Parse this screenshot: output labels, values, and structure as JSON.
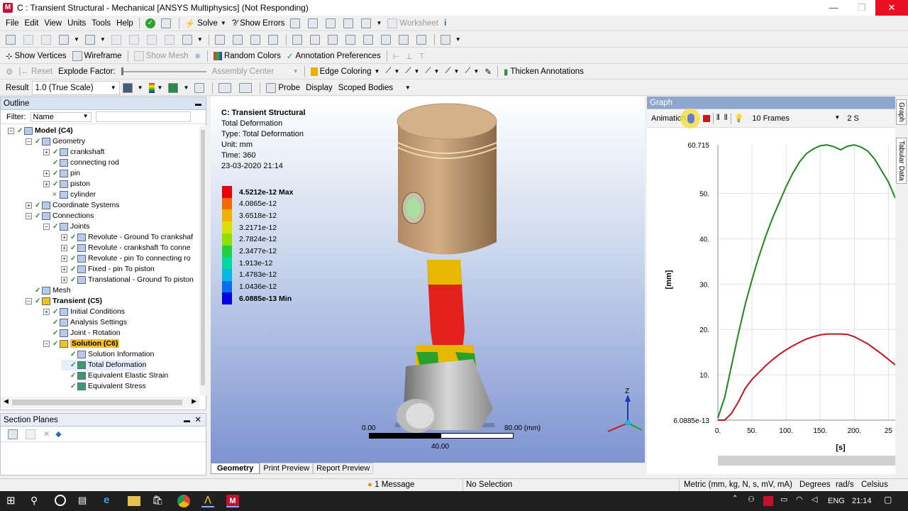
{
  "window": {
    "title": "C : Transient Structural - Mechanical [ANSYS Multiphysics] (Not Responding)",
    "minimize": "—",
    "maximize": "❐",
    "close": "✕"
  },
  "menu": [
    "File",
    "Edit",
    "View",
    "Units",
    "Tools",
    "Help"
  ],
  "toolbar1": {
    "solve": "Solve",
    "show_errors": "Show Errors",
    "worksheet": "Worksheet"
  },
  "toolbar3": {
    "show_vertices": "Show Vertices",
    "wireframe": "Wireframe",
    "show_mesh": "Show Mesh",
    "random_colors": "Random Colors",
    "annotation_preferences": "Annotation Preferences"
  },
  "toolbar4": {
    "reset": "Reset",
    "explode_factor": "Explode Factor:",
    "assembly_center": "Assembly Center",
    "edge_coloring": "Edge Coloring",
    "thicken_annotations": "Thicken Annotations"
  },
  "toolbar5": {
    "result_label": "Result",
    "result_value": "1.0 (True Scale)",
    "probe": "Probe",
    "display": "Display",
    "display_value": "Scoped Bodies"
  },
  "outline": {
    "title": "Outline",
    "pin": "📌",
    "filter_label": "Filter:",
    "filter_value": "Name",
    "items": [
      {
        "label": "Model (C4)",
        "bold": true
      },
      {
        "label": "Geometry"
      },
      {
        "label": "crankshaft"
      },
      {
        "label": "connecting rod"
      },
      {
        "label": "pin"
      },
      {
        "label": "piston"
      },
      {
        "label": "cylinder"
      },
      {
        "label": "Coordinate Systems"
      },
      {
        "label": "Connections"
      },
      {
        "label": "Joints"
      },
      {
        "label": "Revolute - Ground To crankshaf"
      },
      {
        "label": "Revolute - crankshaft To conne"
      },
      {
        "label": "Revolute - pin To connecting ro"
      },
      {
        "label": "Fixed - pin To piston"
      },
      {
        "label": "Translational - Ground To piston"
      },
      {
        "label": "Mesh"
      },
      {
        "label": "Transient (C5)",
        "bold": true
      },
      {
        "label": "Initial Conditions"
      },
      {
        "label": "Analysis Settings"
      },
      {
        "label": "Joint - Rotation"
      },
      {
        "label": "Solution (C6)",
        "bold": true
      },
      {
        "label": "Solution Information"
      },
      {
        "label": "Total Deformation"
      },
      {
        "label": "Equivalent Elastic Strain"
      },
      {
        "label": "Equivalent Stress"
      }
    ]
  },
  "section_planes": {
    "title": "Section Planes"
  },
  "viewport": {
    "title": "C: Transient Structural",
    "lines": [
      "Total Deformation",
      "Type: Total Deformation",
      "Unit: mm",
      "Time: 360",
      "23-03-2020 21:14"
    ],
    "legend": [
      {
        "value": "4.5212e-12 Max",
        "color": "#e8000b"
      },
      {
        "value": "4.0865e-12",
        "color": "#f26a00"
      },
      {
        "value": "3.6518e-12",
        "color": "#f0b000"
      },
      {
        "value": "3.2171e-12",
        "color": "#d8e000"
      },
      {
        "value": "2.7824e-12",
        "color": "#8ee000"
      },
      {
        "value": "2.3477e-12",
        "color": "#20d040"
      },
      {
        "value": "1.913e-12",
        "color": "#00d8a0"
      },
      {
        "value": "1.4783e-12",
        "color": "#00b8e8"
      },
      {
        "value": "1.0436e-12",
        "color": "#0070f0"
      },
      {
        "value": "6.0885e-13 Min",
        "color": "#0000e0"
      }
    ],
    "scale": {
      "left": "0.00",
      "right": "80.00 (mm)",
      "mid": "40.00"
    },
    "axis_z": "Z",
    "tabs": [
      "Geometry",
      "Print Preview",
      "Report Preview"
    ]
  },
  "graph": {
    "title": "Graph",
    "animation": "Animation",
    "frames": "10 Frames",
    "rate": "2 S",
    "side_tabs": [
      "Graph",
      "Tabular Data"
    ],
    "ylabel": "[mm]",
    "xlabel": "[s]"
  },
  "chart_data": {
    "type": "line",
    "xlabel": "[s]",
    "ylabel": "[mm]",
    "xlim": [
      0,
      260
    ],
    "ylim": [
      6.0885e-13,
      60.715
    ],
    "x_ticks": [
      "0.",
      "50.",
      "100.",
      "150.",
      "200.",
      "25"
    ],
    "y_ticks": [
      "60.715",
      "50.",
      "40.",
      "30.",
      "20.",
      "10.",
      "6.0885e-13"
    ],
    "series": [
      {
        "color": "#1a8a1a",
        "x": [
          0,
          10,
          20,
          30,
          40,
          50,
          60,
          70,
          80,
          90,
          100,
          110,
          120,
          130,
          140,
          150,
          160,
          170,
          180,
          190,
          200,
          210,
          220,
          230,
          240,
          250,
          260
        ],
        "y": [
          0.5,
          5,
          12,
          19,
          25.5,
          31,
          36,
          40.5,
          44.5,
          48,
          51.5,
          54.5,
          57,
          58.8,
          59.8,
          60.5,
          60.7,
          60.3,
          59.6,
          60.4,
          60.7,
          60.2,
          59.3,
          57.5,
          55,
          52.5,
          49
        ]
      },
      {
        "color": "#c0141c",
        "x": [
          0,
          10,
          20,
          30,
          40,
          50,
          60,
          70,
          80,
          90,
          100,
          110,
          120,
          130,
          140,
          150,
          160,
          170,
          180,
          190,
          200,
          210,
          220,
          230,
          240,
          250,
          260
        ],
        "y": [
          0,
          0,
          1.5,
          4,
          7,
          9,
          10.5,
          12,
          13.3,
          14.5,
          15.5,
          16.4,
          17.2,
          17.9,
          18.4,
          18.8,
          19,
          19,
          19,
          18.9,
          18.4,
          17.6,
          16.8,
          15.7,
          14.6,
          13.4,
          12.2
        ]
      }
    ]
  },
  "status": {
    "messages": "1 Message",
    "selection": "No Selection",
    "units": "Metric (mm, kg, N, s, mV, mA)",
    "degrees": "Degrees",
    "rads": "rad/s",
    "celsius": "Celsius"
  },
  "taskbar": {
    "lang": "ENG",
    "time": "21:14"
  }
}
